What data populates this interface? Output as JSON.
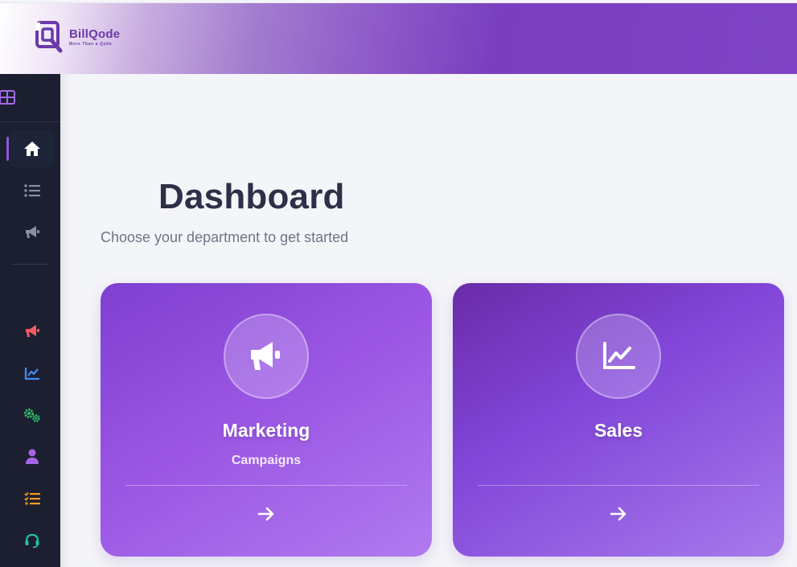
{
  "brand": {
    "name": "BillQode",
    "tagline": "More Than a Qode"
  },
  "sidebar": {
    "top_icon": "grid-icon",
    "items": [
      {
        "icon": "home-icon",
        "active": true
      },
      {
        "icon": "list-icon"
      },
      {
        "icon": "megaphone-icon"
      },
      {
        "icon": "megaphone-icon",
        "color": "#f05b64"
      },
      {
        "icon": "chart-line-icon",
        "color": "#3d8ff0"
      },
      {
        "icon": "gears-icon",
        "color": "#2fbf6a"
      },
      {
        "icon": "user-icon",
        "color": "#a764e8"
      },
      {
        "icon": "tasks-icon",
        "color": "#f59a1c"
      },
      {
        "icon": "headset-icon",
        "color": "#22c2a0"
      }
    ]
  },
  "page": {
    "title": "Dashboard",
    "subtitle": "Choose your department to get started"
  },
  "cards": [
    {
      "title": "Marketing",
      "subtitle": "Campaigns",
      "icon": "megaphone-icon",
      "arrow": "arrow-right-icon"
    },
    {
      "title": "Sales",
      "subtitle": "",
      "icon": "chart-line-icon",
      "arrow": "arrow-right-icon"
    }
  ],
  "colors": {
    "accent": "#7e44c5",
    "sidebar_bg": "#1c1f30",
    "title": "#2d3047",
    "subtitle": "#6f7588"
  }
}
